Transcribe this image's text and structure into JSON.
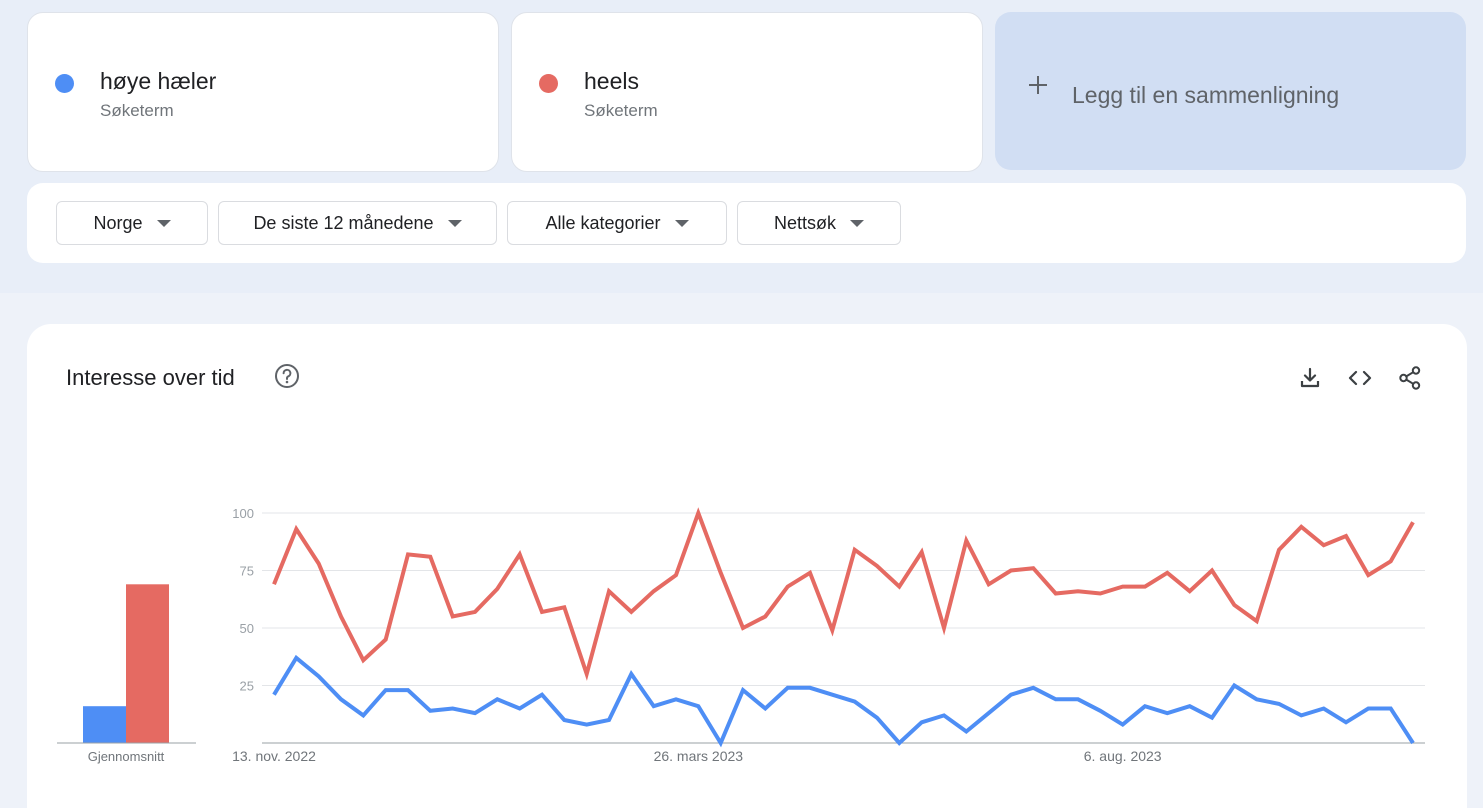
{
  "terms": [
    {
      "name": "høye hæler",
      "sub": "Søketerm",
      "color": "#4e8ef5"
    },
    {
      "name": "heels",
      "sub": "Søketerm",
      "color": "#e56a62"
    }
  ],
  "add_compare": {
    "label": "Legg til en sammenligning"
  },
  "filters": [
    {
      "label": "Norge"
    },
    {
      "label": "De siste 12 månedene"
    },
    {
      "label": "Alle kategorier"
    },
    {
      "label": "Nettsøk"
    }
  ],
  "chart_card": {
    "title": "Interesse over tid"
  },
  "icons": {
    "help": "help-circle-icon",
    "download": "download-icon",
    "embed": "code-icon",
    "share": "share-icon"
  },
  "chart_data": [
    {
      "type": "bar",
      "categories": [
        "høye hæler",
        "heels"
      ],
      "values": [
        16,
        69
      ],
      "xlabel": "Gjennomsnitt",
      "colors": [
        "#4e8ef5",
        "#e56a62"
      ],
      "ylim": [
        0,
        100
      ]
    },
    {
      "type": "line",
      "ylim": [
        0,
        100
      ],
      "yticks": [
        "100",
        "75",
        "50",
        "25"
      ],
      "grid": true,
      "xtick_labels": [
        {
          "label": "13. nov. 2022",
          "index": 0
        },
        {
          "label": "26. mars 2023",
          "index": 19
        },
        {
          "label": "6. aug. 2023",
          "index": 38
        }
      ],
      "series": [
        {
          "name": "heels",
          "color": "#e56a62",
          "values": [
            69,
            93,
            78,
            55,
            36,
            45,
            82,
            81,
            55,
            57,
            67,
            82,
            57,
            59,
            30,
            66,
            57,
            66,
            73,
            100,
            74,
            50,
            55,
            68,
            74,
            49,
            84,
            77,
            68,
            83,
            50,
            88,
            69,
            75,
            76,
            65,
            66,
            65,
            68,
            68,
            74,
            66,
            75,
            60,
            53,
            84,
            94,
            86,
            90,
            73,
            79,
            96
          ]
        },
        {
          "name": "høye hæler",
          "color": "#4e8ef5",
          "values": [
            21,
            37,
            29,
            19,
            12,
            23,
            23,
            14,
            15,
            13,
            19,
            15,
            21,
            10,
            8,
            10,
            30,
            16,
            19,
            16,
            0,
            23,
            15,
            24,
            24,
            21,
            18,
            11,
            0,
            9,
            12,
            5,
            13,
            21,
            24,
            19,
            19,
            14,
            8,
            16,
            13,
            16,
            11,
            25,
            19,
            17,
            12,
            15,
            9,
            15,
            15,
            0
          ]
        }
      ]
    }
  ]
}
